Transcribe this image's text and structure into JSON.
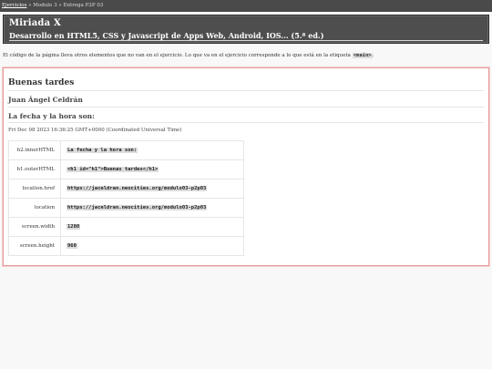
{
  "breadcrumb": {
    "link": "Ejercicios",
    "rest": " » Modulo 3 » Entrega P2P 03"
  },
  "header": {
    "title": "Miriada X",
    "subtitle": "Desarrollo en HTML5, CSS y Javascript de Apps Web, Android, IOS... (5.ª ed.)"
  },
  "note": {
    "text_before": "El código de la página lleva otros elementos que no van en el ejercicio. Lo que va en el ejercicio corresponde a lo que está en la etiqueta ",
    "code": "<main>",
    "text_after": "."
  },
  "main": {
    "h1": "Buenas tardes",
    "h2": "Juan Ángel Celdrán",
    "h3": "La fecha y la hora son:",
    "date": "Fri Dec 08 2023 16:36:25 GMT+0000 (Coordinated Universal Time)",
    "rows": [
      {
        "key": "h2.innerHTML",
        "value": "La fecha y la hora son:"
      },
      {
        "key": "h1.outerHTML",
        "value": "<h1 id=\"h1\">Buenas tardes</h1>"
      },
      {
        "key": "location.href",
        "value": "https://jaceldran.neocities.org/modulo03-p2p03"
      },
      {
        "key": "location",
        "value": "https://jaceldran.neocities.org/modulo03-p2p03"
      },
      {
        "key": "screen.width",
        "value": "1280"
      },
      {
        "key": "screen.height",
        "value": "960"
      }
    ]
  }
}
